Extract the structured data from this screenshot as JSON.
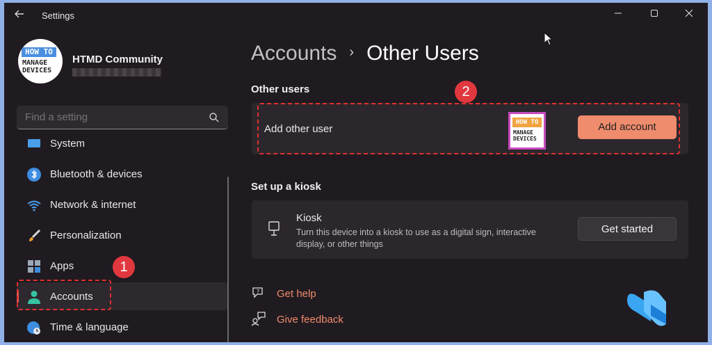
{
  "window": {
    "title": "Settings"
  },
  "profile": {
    "name": "HTMD Community",
    "avatar_top": "HOW TO",
    "avatar_line1": "MANAGE",
    "avatar_line2": "DEVICES"
  },
  "search": {
    "placeholder": "Find a setting"
  },
  "sidebar": {
    "items": [
      {
        "label": "System",
        "icon": "system-icon"
      },
      {
        "label": "Bluetooth & devices",
        "icon": "bluetooth-icon"
      },
      {
        "label": "Network & internet",
        "icon": "wifi-icon"
      },
      {
        "label": "Personalization",
        "icon": "brush-icon"
      },
      {
        "label": "Apps",
        "icon": "apps-icon"
      },
      {
        "label": "Accounts",
        "icon": "person-icon",
        "active": true
      },
      {
        "label": "Time & language",
        "icon": "globe-clock-icon"
      }
    ]
  },
  "breadcrumb": {
    "parent": "Accounts",
    "separator": "›",
    "current": "Other Users"
  },
  "other_users": {
    "title": "Other users",
    "row_label": "Add other user",
    "button": "Add account",
    "logo_top": "HOW TO",
    "logo_line1": "MANAGE",
    "logo_line2": "DEVICES"
  },
  "kiosk": {
    "title": "Set up a kiosk",
    "row_title": "Kiosk",
    "row_desc1": "Turn this device into a kiosk to use as a digital sign, interactive",
    "row_desc2": "display, or other things",
    "button": "Get started"
  },
  "links": {
    "help": "Get help",
    "feedback": "Give feedback"
  },
  "annotations": {
    "badge1": "1",
    "badge2": "2"
  },
  "colors": {
    "accent": "#ef8c6d",
    "highlight": "#e23030",
    "background": "#201b20"
  }
}
